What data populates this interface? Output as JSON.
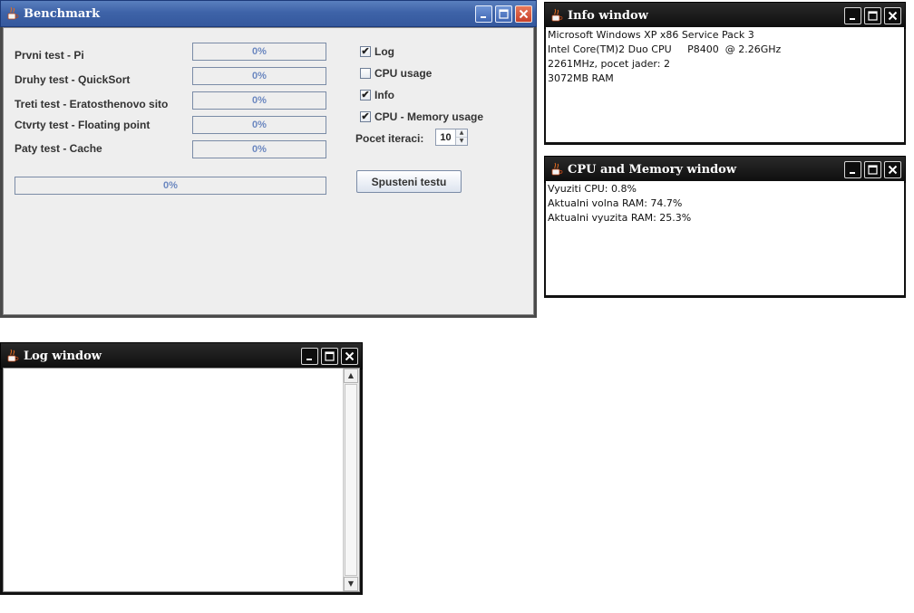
{
  "benchmark": {
    "title": "Benchmark",
    "tests": [
      {
        "label": "Prvni test - Pi",
        "progress": "0%"
      },
      {
        "label": "Druhy test - QuickSort",
        "progress": "0%"
      },
      {
        "label": "Treti test - Eratosthenovo sito",
        "progress": "0%"
      },
      {
        "label": "Ctvrty test - Floating point",
        "progress": "0%"
      },
      {
        "label": "Paty test - Cache",
        "progress": "0%"
      }
    ],
    "total_progress": "0%",
    "options": [
      {
        "label": "Log",
        "checked": true
      },
      {
        "label": "CPU usage",
        "checked": false
      },
      {
        "label": "Info",
        "checked": true
      },
      {
        "label": "CPU - Memory usage",
        "checked": true
      }
    ],
    "iterations_label": "Pocet iteraci:",
    "iterations_value": "10",
    "run_button": "Spusteni testu"
  },
  "info_window": {
    "title": "Info window",
    "lines": [
      "Microsoft Windows XP x86 Service Pack 3",
      "Intel Core(TM)2 Duo CPU     P8400  @ 2.26GHz",
      "2261MHz, pocet jader: 2",
      "3072MB RAM"
    ]
  },
  "cpu_memory_window": {
    "title": "CPU and Memory window",
    "lines": [
      "Vyuziti CPU: 0.8%",
      "Aktualni volna RAM: 74.7%",
      "Aktualni vyuzita RAM: 25.3%"
    ]
  },
  "log_window": {
    "title": "Log window",
    "content": ""
  }
}
